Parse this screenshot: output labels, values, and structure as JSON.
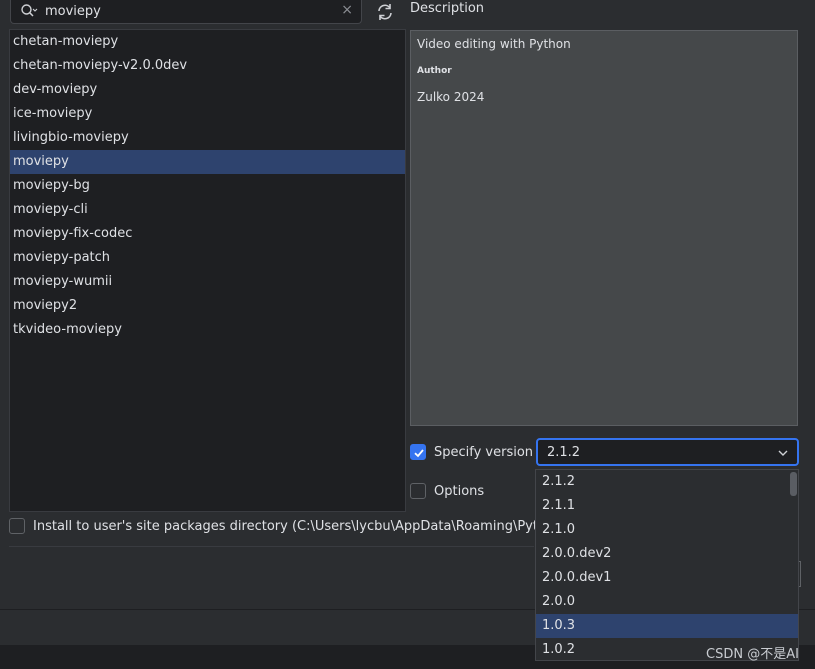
{
  "search": {
    "value": "moviepy",
    "clear_glyph": "×"
  },
  "packages": [
    "chetan-moviepy",
    "chetan-moviepy-v2.0.0dev",
    "dev-moviepy",
    "ice-moviepy",
    "livingbio-moviepy",
    "moviepy",
    "moviepy-bg",
    "moviepy-cli",
    "moviepy-fix-codec",
    "moviepy-patch",
    "moviepy-wumii",
    "moviepy2",
    "tkvideo-moviepy"
  ],
  "selected_package": "moviepy",
  "description": {
    "title": "Description",
    "summary": "Video editing with Python",
    "author_label": "Author",
    "author": "Zulko 2024"
  },
  "specify_version": {
    "label": "Specify version",
    "checked": true,
    "value": "2.1.2"
  },
  "options": {
    "label": "Options",
    "checked": false
  },
  "install_user": {
    "label": "Install to user's site packages directory (C:\\Users\\lycbu\\AppData\\Roaming\\Python)",
    "checked": false
  },
  "versions": [
    "2.1.2",
    "2.1.1",
    "2.1.0",
    "2.0.0.dev2",
    "2.0.0.dev1",
    "2.0.0",
    "1.0.3",
    "1.0.2"
  ],
  "highlighted_version": "1.0.3",
  "watermark": "CSDN @不是AI",
  "colors": {
    "accent": "#3574f0",
    "selection": "#2e436e",
    "panel": "#1e1f22",
    "background": "#2b2d30"
  }
}
